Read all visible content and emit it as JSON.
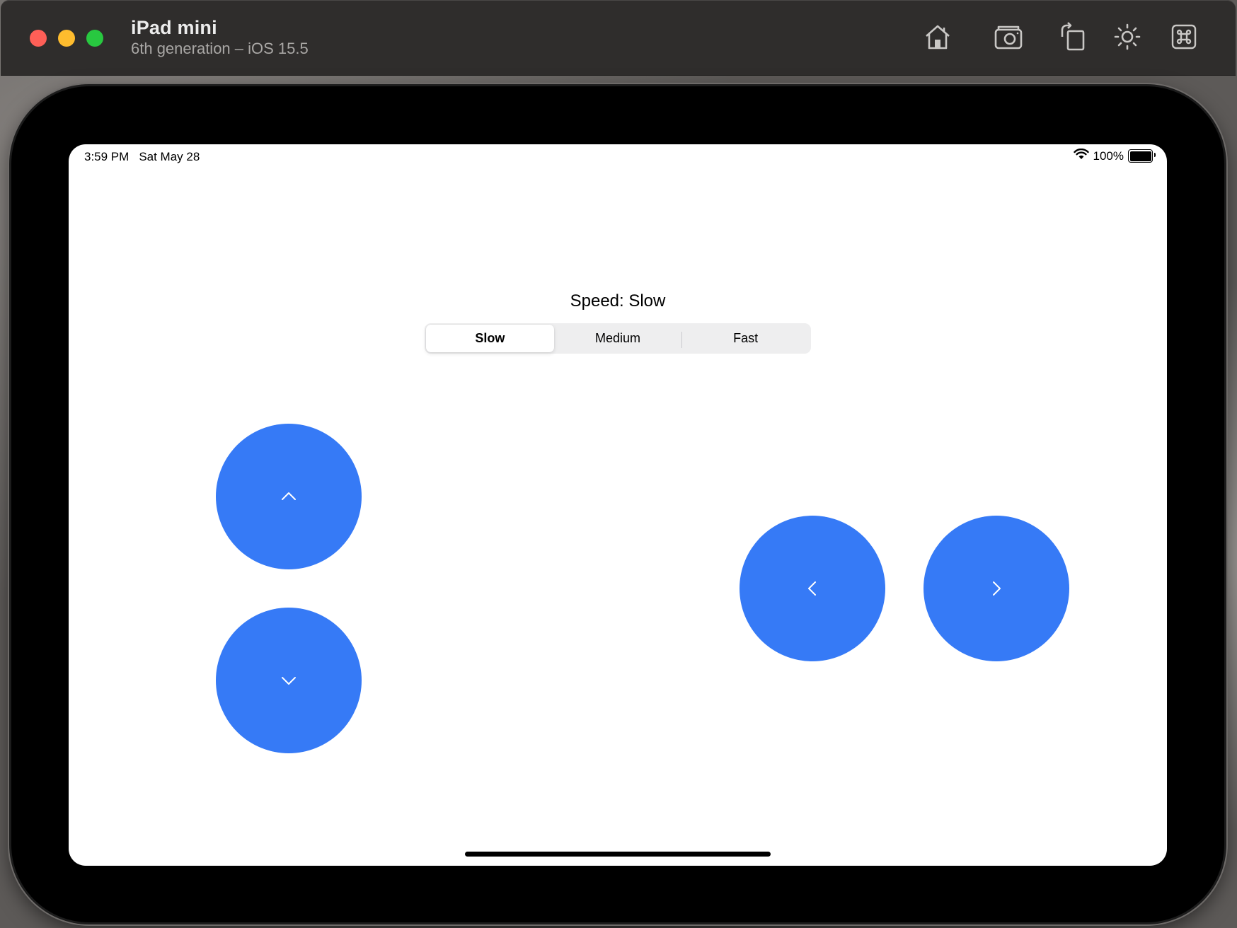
{
  "window": {
    "title": "iPad mini",
    "subtitle": "6th generation – iOS 15.5",
    "toolbar_icons": [
      "home-icon",
      "screenshot-icon",
      "rotate-icon",
      "appearance-icon",
      "command-icon"
    ]
  },
  "status_bar": {
    "time": "3:59 PM",
    "date": "Sat May 28",
    "battery_text": "100%",
    "battery_level": 1.0
  },
  "app": {
    "speed_label": "Speed: Slow",
    "segments": [
      "Slow",
      "Medium",
      "Fast"
    ],
    "selected_segment": "Slow",
    "button_color": "#367af6",
    "buttons": {
      "up_icon": "chevron-up-icon",
      "down_icon": "chevron-down-icon",
      "left_icon": "chevron-left-icon",
      "right_icon": "chevron-right-icon"
    }
  }
}
